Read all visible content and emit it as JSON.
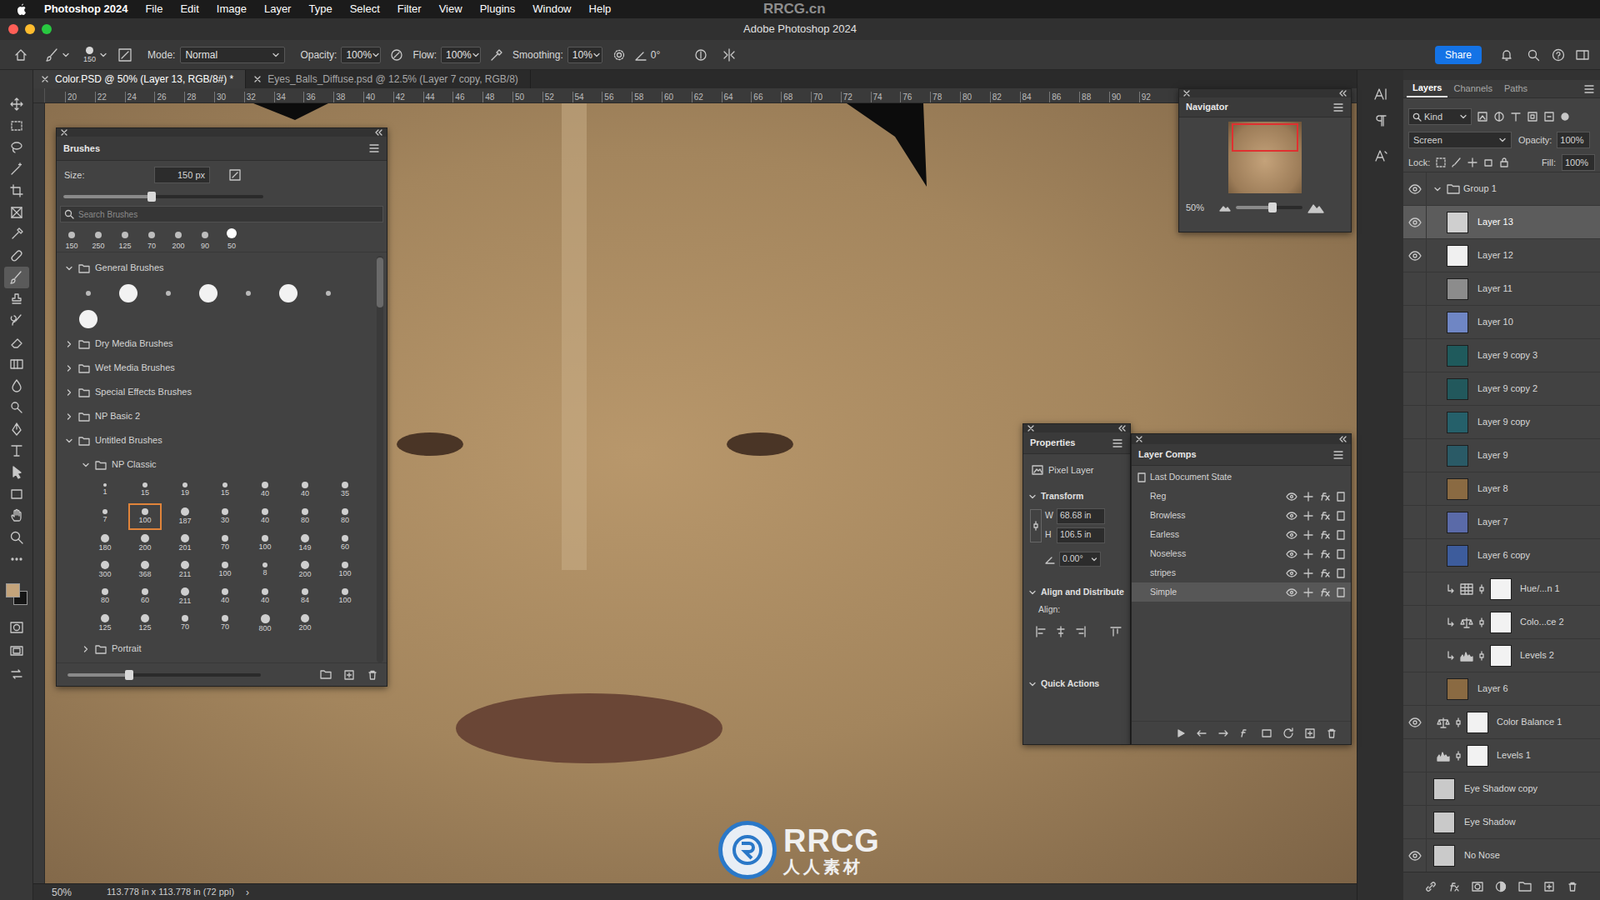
{
  "watermark": {
    "header": "RRCG.cn",
    "logo": "RRCG",
    "sub": "人人素材"
  },
  "menubar": {
    "app": "Photoshop 2024",
    "items": [
      "File",
      "Edit",
      "Image",
      "Layer",
      "Type",
      "Select",
      "Filter",
      "View",
      "Plugins",
      "Window",
      "Help"
    ]
  },
  "window": {
    "title": "Adobe Photoshop 2024"
  },
  "options": {
    "brush_size": "150",
    "mode_label": "Mode:",
    "mode": "Normal",
    "opacity_label": "Opacity:",
    "opacity": "100%",
    "flow_label": "Flow:",
    "flow": "100%",
    "smoothing_label": "Smoothing:",
    "smoothing": "10%",
    "angle": "0°",
    "share": "Share"
  },
  "toolbar": {
    "tools": [
      {
        "kind": "move",
        "selected": false
      },
      {
        "kind": "marquee",
        "selected": false
      },
      {
        "kind": "lasso",
        "selected": false
      },
      {
        "kind": "wand",
        "selected": false
      },
      {
        "kind": "crop",
        "selected": false
      },
      {
        "kind": "frame",
        "selected": false
      },
      {
        "kind": "eyedropper",
        "selected": false
      },
      {
        "kind": "healing",
        "selected": false
      },
      {
        "kind": "brush",
        "selected": true
      },
      {
        "kind": "stamp",
        "selected": false
      },
      {
        "kind": "history",
        "selected": false
      },
      {
        "kind": "eraser",
        "selected": false
      },
      {
        "kind": "gradient",
        "selected": false
      },
      {
        "kind": "blur",
        "selected": false
      },
      {
        "kind": "dodge",
        "selected": false
      },
      {
        "kind": "pen",
        "selected": false
      },
      {
        "kind": "type",
        "selected": false
      },
      {
        "kind": "pathselect",
        "selected": false
      },
      {
        "kind": "rectangle",
        "selected": false
      },
      {
        "kind": "hand",
        "selected": false
      },
      {
        "kind": "zoom",
        "selected": false
      },
      {
        "kind": "more",
        "selected": false
      }
    ],
    "swatches": [
      {
        "color": "#c4a47b"
      },
      {
        "color": "#151515"
      }
    ]
  },
  "tabs": [
    {
      "label": "Color.PSD @ 50% (Layer 13, RGB/8#) *",
      "selected": true
    },
    {
      "label": "Eyes_Balls_Diffuse.psd @ 12.5% (Layer 7 copy, RGB/8)",
      "selected": false
    }
  ],
  "ruler": [
    "20",
    "22",
    "24",
    "26",
    "28",
    "30",
    "32",
    "34",
    "36",
    "38",
    "40",
    "42",
    "44",
    "46",
    "48",
    "50",
    "52",
    "54",
    "56",
    "58",
    "60",
    "62",
    "64",
    "66",
    "68",
    "70",
    "72",
    "74",
    "76",
    "78",
    "80",
    "82",
    "84",
    "86",
    "88",
    "90",
    "92"
  ],
  "brushes": {
    "title": "Brushes",
    "size_label": "Size:",
    "size": "150 px",
    "size_level": 0.44,
    "search_placeholder": "Search Brushes",
    "recent": [
      "150",
      "250",
      "125",
      "70",
      "200",
      "90",
      "50"
    ],
    "folders": [
      {
        "name": "General Brushes",
        "expanded": true,
        "depth": 0,
        "tips": [
          {
            "kind": "small"
          },
          {
            "kind": "large"
          },
          {
            "kind": "small"
          },
          {
            "kind": "large"
          },
          {
            "kind": "small"
          },
          {
            "kind": "large"
          },
          {
            "kind": "small"
          },
          {
            "kind": "large"
          }
        ]
      },
      {
        "name": "Dry Media Brushes",
        "expanded": false,
        "depth": 0
      },
      {
        "name": "Wet Media Brushes",
        "expanded": false,
        "depth": 0
      },
      {
        "name": "Special Effects Brushes",
        "expanded": false,
        "depth": 0
      },
      {
        "name": "NP Basic 2",
        "expanded": false,
        "depth": 0
      },
      {
        "name": "Untitled Brushes",
        "expanded": true,
        "depth": 0
      },
      {
        "name": "NP Classic",
        "expanded": true,
        "depth": 1,
        "tips": [
          {
            "label": "1",
            "selected": false
          },
          {
            "label": "15",
            "selected": false
          },
          {
            "label": "19",
            "selected": false
          },
          {
            "label": "15",
            "selected": false
          },
          {
            "label": "40",
            "selected": false
          },
          {
            "label": "40",
            "selected": false
          },
          {
            "label": "35",
            "selected": false
          },
          {
            "label": "7",
            "selected": false
          },
          {
            "label": "100",
            "selected": true
          },
          {
            "label": "187",
            "selected": false
          },
          {
            "label": "30",
            "selected": false
          },
          {
            "label": "40",
            "selected": false
          },
          {
            "label": "80",
            "selected": false
          },
          {
            "label": "80",
            "selected": false
          },
          {
            "label": "180",
            "selected": false
          },
          {
            "label": "200",
            "selected": false
          },
          {
            "label": "201",
            "selected": false
          },
          {
            "label": "70",
            "selected": false
          },
          {
            "label": "100",
            "selected": false
          },
          {
            "label": "149",
            "selected": false
          },
          {
            "label": "60",
            "selected": false
          },
          {
            "label": "300",
            "selected": false
          },
          {
            "label": "368",
            "selected": false
          },
          {
            "label": "211",
            "selected": false
          },
          {
            "label": "100",
            "selected": false
          },
          {
            "label": "8",
            "selected": false
          },
          {
            "label": "200",
            "selected": false
          },
          {
            "label": "100",
            "selected": false
          },
          {
            "label": "80",
            "selected": false
          },
          {
            "label": "60",
            "selected": false
          },
          {
            "label": "211",
            "selected": false
          },
          {
            "label": "40",
            "selected": false
          },
          {
            "label": "40",
            "selected": false
          },
          {
            "label": "84",
            "selected": false
          },
          {
            "label": "100",
            "selected": false
          },
          {
            "label": "125",
            "selected": false
          },
          {
            "label": "125",
            "selected": false
          },
          {
            "label": "70",
            "selected": false
          },
          {
            "label": "70",
            "selected": false
          },
          {
            "label": "800",
            "selected": false
          },
          {
            "label": "200",
            "selected": false
          }
        ]
      },
      {
        "name": "Portrait",
        "expanded": false,
        "depth": 1
      }
    ],
    "zoom_level": 0.32
  },
  "navigator": {
    "title": "Navigator",
    "zoom": "50%",
    "level": 0.55
  },
  "properties": {
    "title": "Properties",
    "kind": "Pixel Layer",
    "transform": {
      "label": "Transform",
      "expanded": true
    },
    "w_label": "W",
    "w": "68.68 in",
    "h_label": "H",
    "h": "106.5 in",
    "angle": "0.00°",
    "align": {
      "label": "Align and Distribute",
      "expanded": true
    },
    "align_label": "Align:",
    "quick": {
      "label": "Quick Actions",
      "expanded": true
    }
  },
  "layer_comps": {
    "title": "Layer Comps",
    "items": [
      {
        "label": "Last Document State",
        "kind": "state",
        "selected": false
      },
      {
        "label": "Reg",
        "kind": "comp",
        "selected": false
      },
      {
        "label": "Browless",
        "kind": "comp",
        "selected": false
      },
      {
        "label": "Earless",
        "kind": "comp",
        "selected": false
      },
      {
        "label": "Noseless",
        "kind": "comp",
        "selected": false
      },
      {
        "label": "stripes",
        "kind": "comp",
        "selected": false
      },
      {
        "label": "Simple",
        "kind": "comp",
        "selected": true
      }
    ]
  },
  "layers": {
    "tabs": [
      {
        "label": "Layers",
        "selected": true
      },
      {
        "label": "Channels",
        "selected": false
      },
      {
        "label": "Paths",
        "selected": false
      }
    ],
    "filter": "Kind",
    "blend": "Screen",
    "opacity_label": "Opacity:",
    "opacity": "100%",
    "lock_label": "Lock:",
    "fill_label": "Fill:",
    "fill": "100%",
    "items": [
      {
        "name": "Group 1",
        "kind": "group",
        "visible": true,
        "expanded": true,
        "selected": false,
        "depth": 0
      },
      {
        "name": "Layer 13",
        "kind": "pixel",
        "visible": true,
        "selected": true,
        "depth": 1,
        "color": "#cfcfcf"
      },
      {
        "name": "Layer 12",
        "kind": "pixel",
        "visible": true,
        "selected": false,
        "depth": 1,
        "color": "#f0f0f0"
      },
      {
        "name": "Layer 11",
        "kind": "pixel",
        "visible": false,
        "selected": false,
        "depth": 1,
        "color": "#8c8c8c"
      },
      {
        "name": "Layer 10",
        "kind": "pixel",
        "visible": false,
        "selected": false,
        "depth": 1,
        "color": "#6f86c4"
      },
      {
        "name": "Layer 9 copy 3",
        "kind": "pixel",
        "visible": false,
        "selected": false,
        "depth": 1,
        "color": "#1f5a5c"
      },
      {
        "name": "Layer 9 copy 2",
        "kind": "pixel",
        "visible": false,
        "selected": false,
        "depth": 1,
        "color": "#22585c"
      },
      {
        "name": "Layer 9 copy",
        "kind": "pixel",
        "visible": false,
        "selected": false,
        "depth": 1,
        "color": "#25606a"
      },
      {
        "name": "Layer 9",
        "kind": "pixel",
        "visible": false,
        "selected": false,
        "depth": 1,
        "color": "#2a5a66"
      },
      {
        "name": "Layer 8",
        "kind": "pixel",
        "visible": false,
        "selected": false,
        "depth": 1,
        "color": "#8a6a42"
      },
      {
        "name": "Layer 7",
        "kind": "pixel",
        "visible": false,
        "selected": false,
        "depth": 1,
        "color": "#5a6aa8"
      },
      {
        "name": "Layer 6 copy",
        "kind": "pixel",
        "visible": false,
        "selected": false,
        "depth": 1,
        "color": "#3d5c9c"
      },
      {
        "name": "Hue/...n 1",
        "kind": "hue",
        "visible": false,
        "selected": false,
        "depth": 1,
        "clipped": true,
        "color": "#f2f2f2"
      },
      {
        "name": "Colo...ce 2",
        "kind": "balance",
        "visible": false,
        "selected": false,
        "depth": 1,
        "clipped": true,
        "color": "#f2f2f2"
      },
      {
        "name": "Levels 2",
        "kind": "levels",
        "visible": false,
        "selected": false,
        "depth": 1,
        "clipped": true,
        "color": "#f2f2f2"
      },
      {
        "name": "Layer 6",
        "kind": "pixel",
        "visible": false,
        "selected": false,
        "depth": 1,
        "color": "#8a6a42"
      },
      {
        "name": "Color Balance 1",
        "kind": "balance",
        "visible": true,
        "selected": false,
        "depth": 0,
        "clipped": false,
        "color": "#f2f2f2"
      },
      {
        "name": "Levels 1",
        "kind": "levels",
        "visible": false,
        "selected": false,
        "depth": 0,
        "clipped": false,
        "color": "#f2f2f2"
      },
      {
        "name": "Eye Shadow copy",
        "kind": "pixel",
        "visible": false,
        "selected": false,
        "depth": 0,
        "color": "#c9c9c9"
      },
      {
        "name": "Eye Shadow",
        "kind": "pixel",
        "visible": false,
        "selected": false,
        "depth": 0,
        "color": "#c9c9c9"
      },
      {
        "name": "No Nose",
        "kind": "pixel",
        "visible": true,
        "selected": false,
        "depth": 0,
        "color": "#cacaca"
      }
    ]
  },
  "status": {
    "zoom": "50%",
    "info": "113.778 in x 113.778 in (72 ppi)",
    "arrow": "›"
  }
}
